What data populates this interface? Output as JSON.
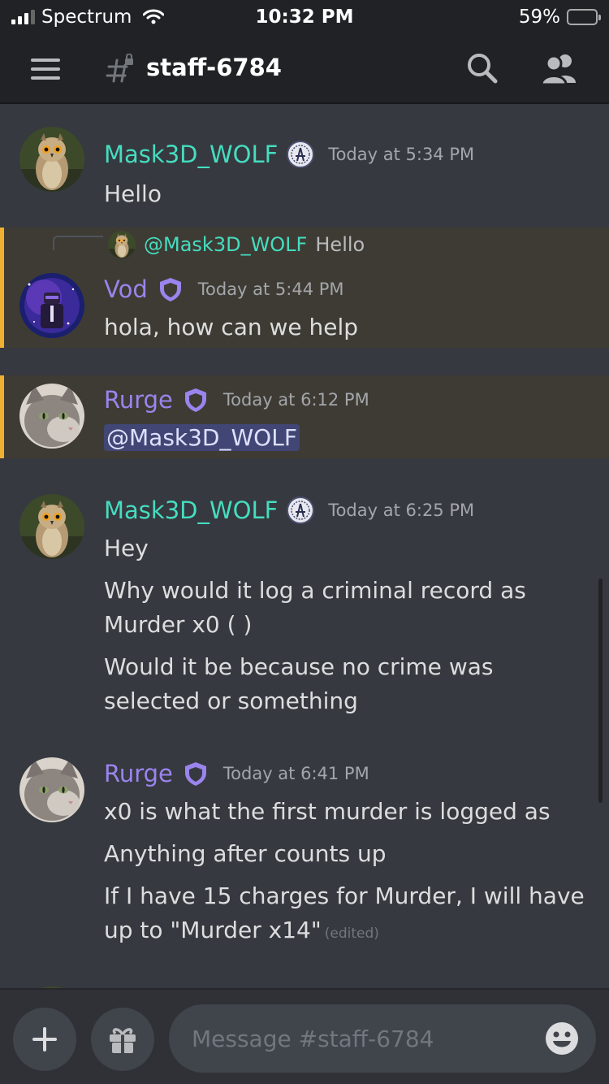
{
  "status_bar": {
    "carrier": "Spectrum",
    "time": "10:32 PM",
    "battery_percent": "59%",
    "battery_level": 0.59,
    "battery_color": "#f5c518"
  },
  "header": {
    "channel_name": "staff-6784",
    "menu_icon": "hamburger-icon",
    "channel_icon": "locked-hash-icon",
    "search_icon": "search-icon",
    "members_icon": "members-icon"
  },
  "colors": {
    "background": "#36393f",
    "mention_highlight": "#3e3b34",
    "mention_border": "#f0b132",
    "teal_role": "#45ddc0",
    "purple_role": "#9b84ee"
  },
  "messages": [
    {
      "author": "Mask3D_WOLF",
      "badge_icon": "server-seal-icon",
      "timestamp": "Today at 5:34 PM",
      "lines": [
        "Hello"
      ]
    },
    {
      "reply_to": {
        "author": "@Mask3D_WOLF",
        "text": "Hello"
      },
      "author": "Vod",
      "badge_icon": "shield-badge-icon",
      "timestamp": "Today at 5:44 PM",
      "lines": [
        "hola, how can we help"
      ]
    },
    {
      "author": "Rurge",
      "badge_icon": "shield-badge-icon",
      "timestamp": "Today at 6:12 PM",
      "mention": "@Mask3D_WOLF"
    },
    {
      "author": "Mask3D_WOLF",
      "badge_icon": "server-seal-icon",
      "timestamp": "Today at 6:25 PM",
      "lines": [
        "Hey",
        "Why would it log a criminal record as Murder x0 ( )",
        "Would it be because no crime was selected or something"
      ]
    },
    {
      "author": "Rurge",
      "badge_icon": "shield-badge-icon",
      "timestamp": "Today at 6:41 PM",
      "lines": [
        "x0 is what the first murder is logged as",
        "Anything after counts up",
        "If I have 15 charges for Murder, I will have up to \"Murder x14\""
      ],
      "edited_label": "(edited)"
    }
  ],
  "composer": {
    "placeholder": "Message #staff-6784",
    "add_icon": "plus-icon",
    "gift_icon": "gift-icon",
    "emoji_icon": "emoji-icon"
  }
}
